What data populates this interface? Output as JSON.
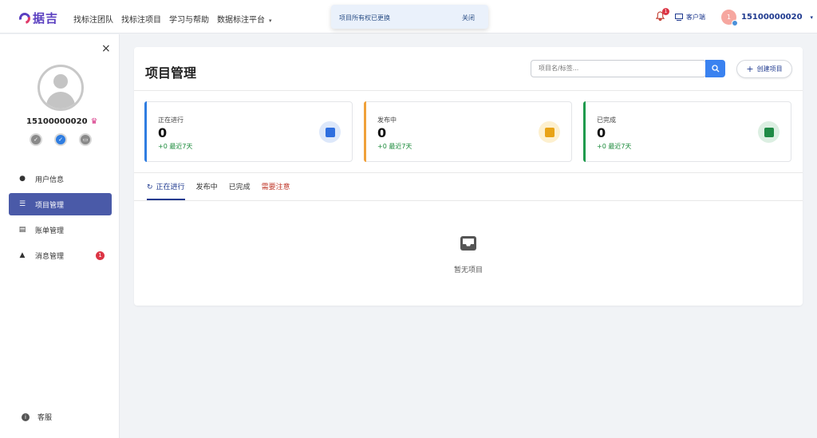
{
  "brand": {
    "logo_text": "据吉",
    "primary_color": "#5a3fc0"
  },
  "nav": {
    "items": [
      "找标注团队",
      "找标注项目",
      "学习与帮助",
      "数据标注平台"
    ],
    "dropdown_caret": "▾"
  },
  "toast": {
    "message": "项目所有权已更换",
    "close_label": "关闭"
  },
  "header": {
    "notification_count": "1",
    "client_label": "客户端",
    "avatar_letter": "1",
    "username": "15100000020",
    "caret": "▾"
  },
  "sidebar": {
    "close_symbol": "×",
    "profile_name": "15100000020",
    "crown_symbol": "♛",
    "badges": [
      "check-icon",
      "verified-icon",
      "card-icon"
    ],
    "items": [
      {
        "label": "用户信息",
        "icon": "user-icon",
        "symbol": "👤",
        "active": false
      },
      {
        "label": "项目管理",
        "icon": "list-icon",
        "symbol": "☰",
        "active": true
      },
      {
        "label": "账单管理",
        "icon": "bill-icon",
        "symbol": "▤",
        "active": false
      },
      {
        "label": "消息管理",
        "icon": "bell-icon",
        "symbol": "🔔",
        "active": false,
        "count": "1"
      }
    ],
    "support_label": "客服",
    "support_symbol": "i"
  },
  "main": {
    "title": "项目管理",
    "search_placeholder": "项目名/标签...",
    "create_label": "创建项目",
    "create_symbol": "+",
    "stats": [
      {
        "label": "正在进行",
        "value": "0",
        "delta": "+0 最近7天",
        "color": "#2f7de1"
      },
      {
        "label": "发布中",
        "value": "0",
        "delta": "+0 最近7天",
        "color": "#f0a13a"
      },
      {
        "label": "已完成",
        "value": "0",
        "delta": "+0 最近7天",
        "color": "#1f9a4d"
      }
    ],
    "tabs": [
      "正在进行",
      "发布中",
      "已完成",
      "需要注意"
    ],
    "active_tab": "正在进行",
    "refresh_symbol": "↻",
    "empty_text": "暂无项目"
  }
}
